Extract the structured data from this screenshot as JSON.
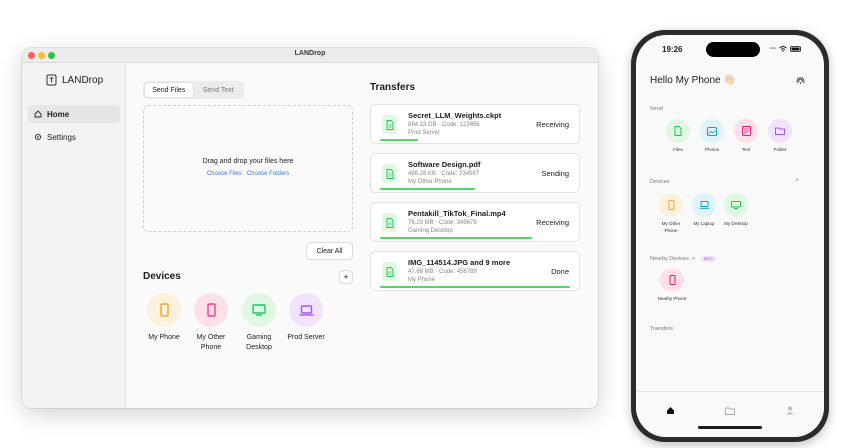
{
  "window": {
    "title": "LANDrop"
  },
  "sidebar": {
    "app_name": "LANDrop",
    "items": [
      {
        "label": "Home",
        "icon": "home-icon"
      },
      {
        "label": "Settings",
        "icon": "gear-icon"
      }
    ]
  },
  "send": {
    "tabs": [
      "Send Files",
      "Send Text"
    ],
    "drop_text": "Drag and drop your files here",
    "choose_files": "Choose Files",
    "choose_folders": "Choose Folders",
    "clear_all": "Clear All"
  },
  "devices": {
    "title": "Devices",
    "add_label": "+",
    "items": [
      {
        "name": "My Phone",
        "icon": "phone-icon",
        "color": "#f5a623"
      },
      {
        "name": "My Other Phone",
        "icon": "phone-icon",
        "color": "#f43f7a"
      },
      {
        "name": "Gaming Desktop",
        "icon": "desktop-icon",
        "color": "#22c55e"
      },
      {
        "name": "Prod Server",
        "icon": "laptop-icon",
        "color": "#a855f7"
      }
    ]
  },
  "transfers": {
    "title": "Transfers",
    "items": [
      {
        "name": "Secret_LLM_Weights.ckpt",
        "meta": "884.33 GB · Code: 123456",
        "device": "Prod Server",
        "status": "Receiving",
        "progress": 0.2
      },
      {
        "name": "Software Design.pdf",
        "meta": "488.28 KB · Code: 234567",
        "device": "My Other Phone",
        "status": "Sending",
        "progress": 0.5
      },
      {
        "name": "Pentakill_TikTok_Final.mp4",
        "meta": "76.29 MB · Code: 345678",
        "device": "Gaming Desktop",
        "status": "Receiving",
        "progress": 0.8
      },
      {
        "name": "IMG_114514.JPG and 9 more",
        "meta": "47.68 MB · Code: 456789",
        "device": "My Phone",
        "status": "Done",
        "progress": 1.0
      }
    ]
  },
  "phone": {
    "time": "19:26",
    "hello": "Hello My Phone 👋🏻",
    "send_label": "Send",
    "send_items": [
      {
        "label": "Files",
        "icon": "file-icon",
        "color": "#22c55e"
      },
      {
        "label": "Photos",
        "icon": "photo-icon",
        "color": "#0ea5c9"
      },
      {
        "label": "Text",
        "icon": "text-icon",
        "color": "#e11d74"
      },
      {
        "label": "Folder",
        "icon": "folder-icon",
        "color": "#a855f7"
      }
    ],
    "devices_label": "Devices",
    "devices_add": "+",
    "device_items": [
      {
        "label": "My Other Phone",
        "icon": "phone-icon",
        "color": "#f5a623"
      },
      {
        "label": "My Laptop",
        "icon": "laptop-icon",
        "color": "#0ea5c9"
      },
      {
        "label": "My Desktop",
        "icon": "desktop-icon",
        "color": "#22c55e"
      }
    ],
    "nearby_label": "Nearby Devices",
    "nearby_chevron": ">",
    "beta_badge": "BETA",
    "nearby_items": [
      {
        "label": "Nearby Phone",
        "icon": "phone-icon",
        "color": "#e11d48"
      }
    ],
    "transfers_label": "Transfers"
  }
}
